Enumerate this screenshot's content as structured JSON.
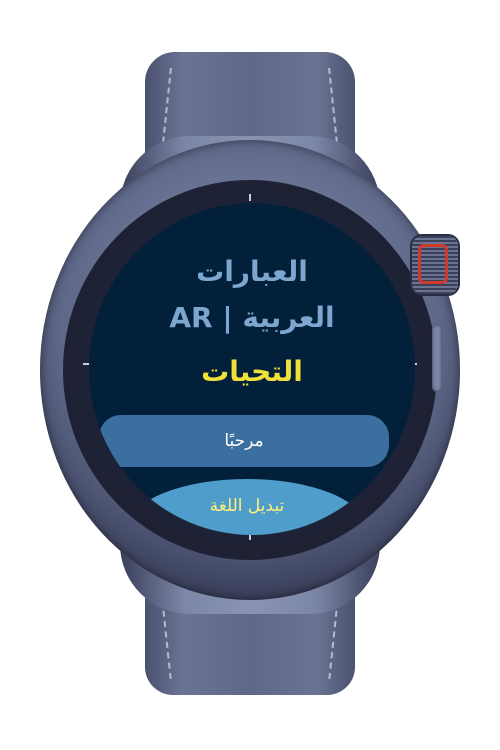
{
  "app": {
    "title_line1": "العبارات",
    "title_line2": "العربية | AR",
    "section": "التحيات"
  },
  "buttons": {
    "greeting": "مرحبًا",
    "change_language": "تبديل اللغة"
  },
  "colors": {
    "screen_bg": "#02203a",
    "title": "#7ea7cf",
    "section": "#f2e03a",
    "primary_button": "#3b6fa0",
    "secondary_button": "#4f9dcb",
    "secondary_text": "#fbf07a",
    "crown_accent": "#d13a2a"
  }
}
